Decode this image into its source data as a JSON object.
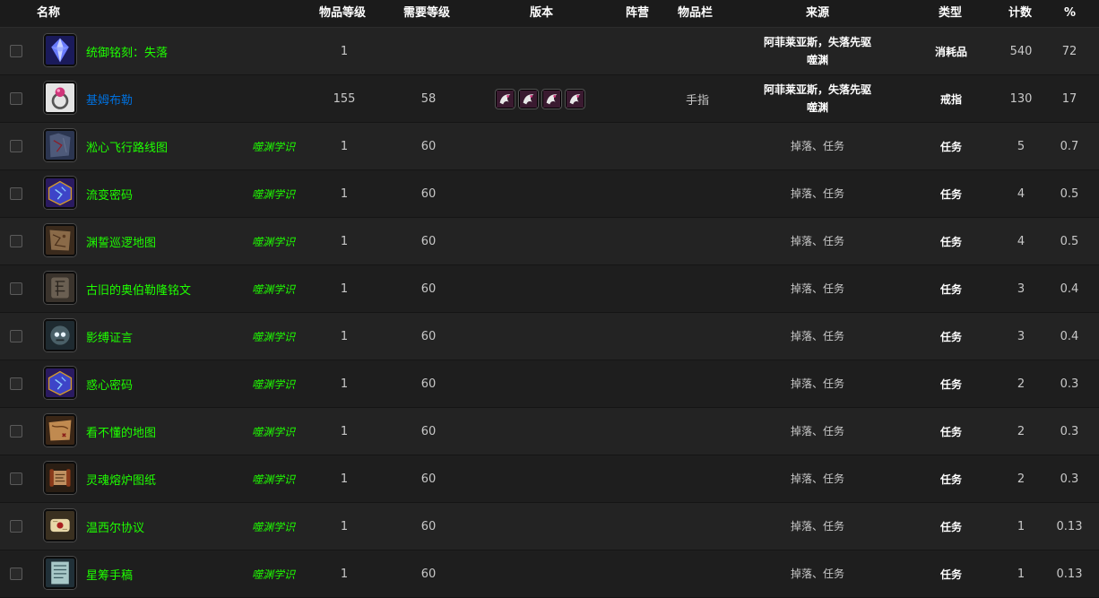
{
  "headers": {
    "name": "名称",
    "item_level": "物品等级",
    "req_level": "需要等级",
    "version": "版本",
    "faction": "阵营",
    "slot": "物品栏",
    "source": "来源",
    "type": "类型",
    "count": "计数",
    "percent": "%"
  },
  "rows": [
    {
      "name": "统御铭刻：失落",
      "quality": "green",
      "icon": "crystal-icon",
      "tag": "",
      "item_level": "1",
      "req_level": "",
      "versions": 0,
      "slot": "",
      "source": [
        "阿菲莱亚斯，失落先驱",
        "噬渊"
      ],
      "source_bold": true,
      "type": "消耗品",
      "count": "540",
      "percent": "72"
    },
    {
      "name": "基姆布勒",
      "quality": "blue",
      "icon": "ring-icon",
      "tag": "",
      "item_level": "155",
      "req_level": "58",
      "versions": 4,
      "slot": "手指",
      "source": [
        "阿菲莱亚斯，失落先驱",
        "噬渊"
      ],
      "source_bold": true,
      "type": "戒指",
      "count": "130",
      "percent": "17"
    },
    {
      "name": "淞心飞行路线图",
      "quality": "green",
      "icon": "map-icon",
      "tag": "噬渊学识",
      "item_level": "1",
      "req_level": "60",
      "versions": 0,
      "slot": "",
      "source": [
        "掉落、任务"
      ],
      "source_bold": false,
      "type": "任务",
      "count": "5",
      "percent": "0.7"
    },
    {
      "name": "流变密码",
      "quality": "green",
      "icon": "cipher-cube-icon",
      "tag": "噬渊学识",
      "item_level": "1",
      "req_level": "60",
      "versions": 0,
      "slot": "",
      "source": [
        "掉落、任务"
      ],
      "source_bold": false,
      "type": "任务",
      "count": "4",
      "percent": "0.5"
    },
    {
      "name": "渊誓巡逻地图",
      "quality": "green",
      "icon": "parchment-map-icon",
      "tag": "噬渊学识",
      "item_level": "1",
      "req_level": "60",
      "versions": 0,
      "slot": "",
      "source": [
        "掉落、任务"
      ],
      "source_bold": false,
      "type": "任务",
      "count": "4",
      "percent": "0.5"
    },
    {
      "name": "古旧的奥伯勒隆铭文",
      "quality": "green",
      "icon": "rune-tablet-icon",
      "tag": "噬渊学识",
      "item_level": "1",
      "req_level": "60",
      "versions": 0,
      "slot": "",
      "source": [
        "掉落、任务"
      ],
      "source_bold": false,
      "type": "任务",
      "count": "3",
      "percent": "0.4"
    },
    {
      "name": "影缚证言",
      "quality": "green",
      "icon": "skull-orb-icon",
      "tag": "噬渊学识",
      "item_level": "1",
      "req_level": "60",
      "versions": 0,
      "slot": "",
      "source": [
        "掉落、任务"
      ],
      "source_bold": false,
      "type": "任务",
      "count": "3",
      "percent": "0.4"
    },
    {
      "name": "惑心密码",
      "quality": "green",
      "icon": "cipher-cube-icon",
      "tag": "噬渊学识",
      "item_level": "1",
      "req_level": "60",
      "versions": 0,
      "slot": "",
      "source": [
        "掉落、任务"
      ],
      "source_bold": false,
      "type": "任务",
      "count": "2",
      "percent": "0.3"
    },
    {
      "name": "看不懂的地图",
      "quality": "green",
      "icon": "treasure-map-icon",
      "tag": "噬渊学识",
      "item_level": "1",
      "req_level": "60",
      "versions": 0,
      "slot": "",
      "source": [
        "掉落、任务"
      ],
      "source_bold": false,
      "type": "任务",
      "count": "2",
      "percent": "0.3"
    },
    {
      "name": "灵魂熔炉图纸",
      "quality": "green",
      "icon": "blueprint-scroll-icon",
      "tag": "噬渊学识",
      "item_level": "1",
      "req_level": "60",
      "versions": 0,
      "slot": "",
      "source": [
        "掉落、任务"
      ],
      "source_bold": false,
      "type": "任务",
      "count": "2",
      "percent": "0.3"
    },
    {
      "name": "温西尔协议",
      "quality": "green",
      "icon": "sealed-scroll-icon",
      "tag": "噬渊学识",
      "item_level": "1",
      "req_level": "60",
      "versions": 0,
      "slot": "",
      "source": [
        "掉落、任务"
      ],
      "source_bold": false,
      "type": "任务",
      "count": "1",
      "percent": "0.13"
    },
    {
      "name": "星筹手稿",
      "quality": "green",
      "icon": "manuscript-icon",
      "tag": "噬渊学识",
      "item_level": "1",
      "req_level": "60",
      "versions": 0,
      "slot": "",
      "source": [
        "掉落、任务"
      ],
      "source_bold": false,
      "type": "任务",
      "count": "1",
      "percent": "0.13"
    }
  ],
  "version_icon": "dragon-emblem-icon",
  "colors": {
    "green_quality": "#1eff00",
    "blue_quality": "#0070dd",
    "background": "#1c1c1c"
  }
}
